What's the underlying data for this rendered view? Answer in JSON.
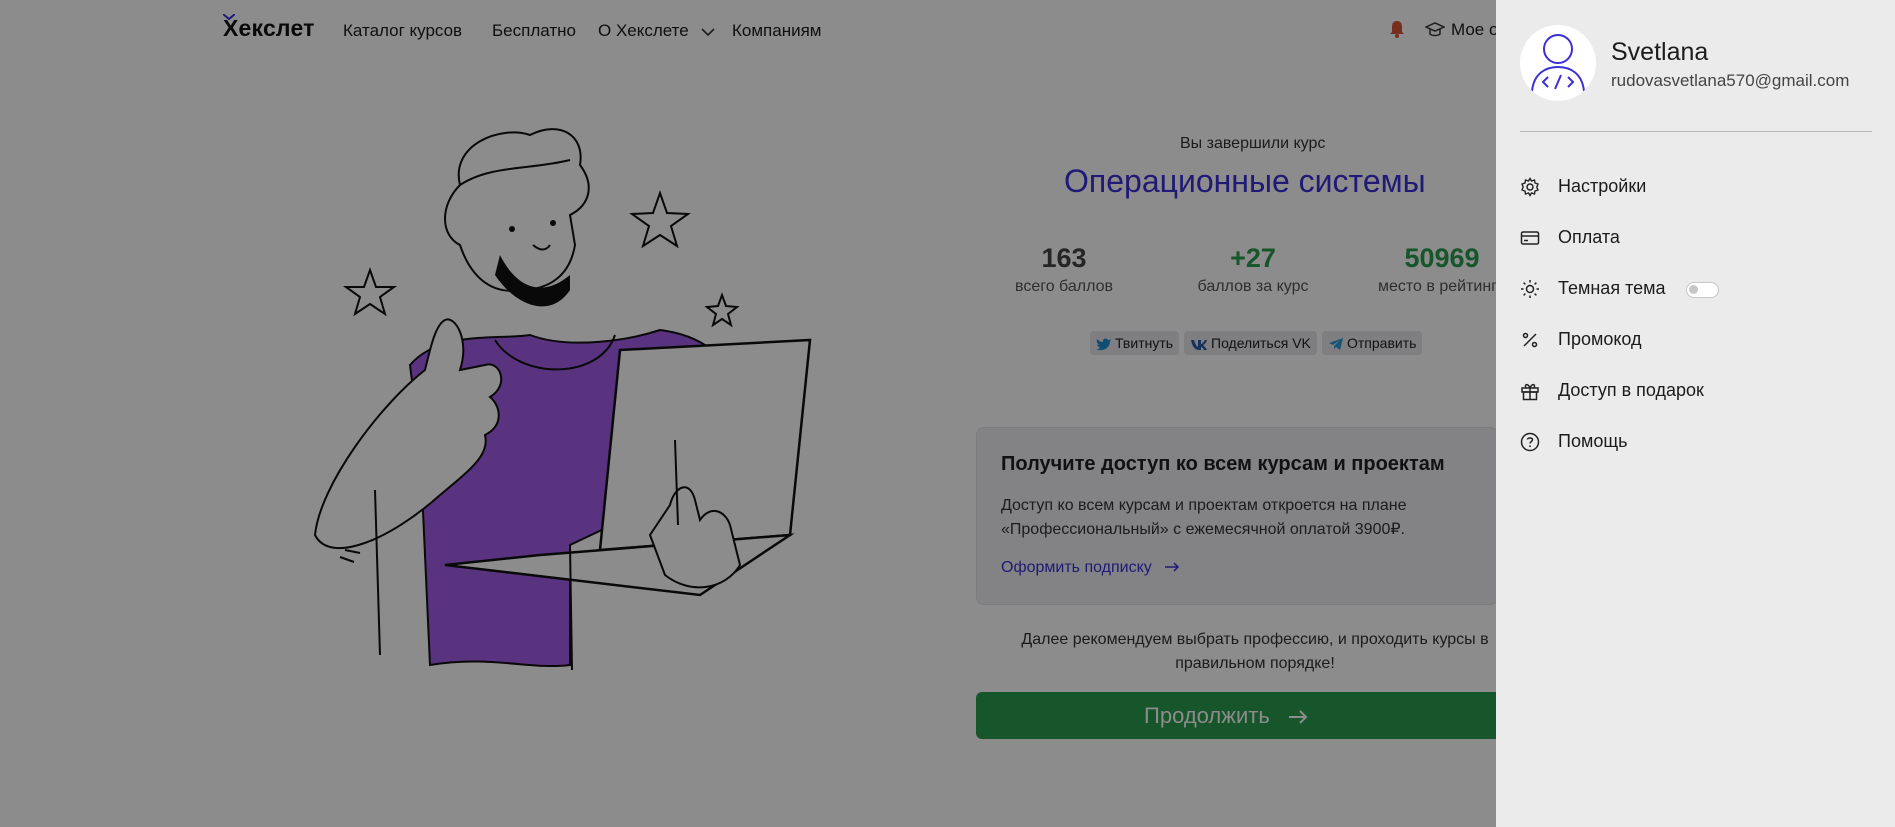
{
  "header": {
    "logo": "Хекслет",
    "nav": [
      "Каталог курсов",
      "Бесплатно",
      "О Хекслете",
      "Компаниям"
    ],
    "my_courses": "Мое о"
  },
  "hero": {
    "completed_label": "Вы завершили курс",
    "course_title": "Операционные системы",
    "stats": [
      {
        "value": "163",
        "label": "всего баллов",
        "color": "#444444"
      },
      {
        "value": "+27",
        "label": "баллов за курс",
        "color": "#2a9b4f"
      },
      {
        "value": "50969",
        "label": "место в рейтинг",
        "color": "#2a9b4f"
      }
    ],
    "share": {
      "twitter": "Твитнуть",
      "vk": "Поделиться VK",
      "telegram": "Отправить"
    }
  },
  "promo": {
    "title": "Получите доступ ко всем курсам и проектам",
    "text": "Доступ ко всем курсам и проектам откроется на плане «Профессиональный» с ежемесячной оплатой 3900₽.",
    "link": "Оформить подписку"
  },
  "recommend_text": "Далее рекомендуем выбрать профессию, и проходить курсы в правильном порядке!",
  "continue_button": "Продолжить",
  "drawer": {
    "user_name": "Svetlana",
    "user_email": "rudovasvetlana570@gmail.com",
    "menu": [
      {
        "label": "Настройки",
        "icon": "gear-icon"
      },
      {
        "label": "Оплата",
        "icon": "card-icon"
      },
      {
        "label": "Темная тема",
        "icon": "sun-icon",
        "toggle": false
      },
      {
        "label": "Промокод",
        "icon": "percent-icon"
      },
      {
        "label": "Доступ в подарок",
        "icon": "gift-icon"
      },
      {
        "label": "Помощь",
        "icon": "help-icon"
      }
    ]
  },
  "colors": {
    "accent": "#3b2fd6",
    "success": "#2a9b4f",
    "illustration_shirt": "#a35ee8"
  }
}
